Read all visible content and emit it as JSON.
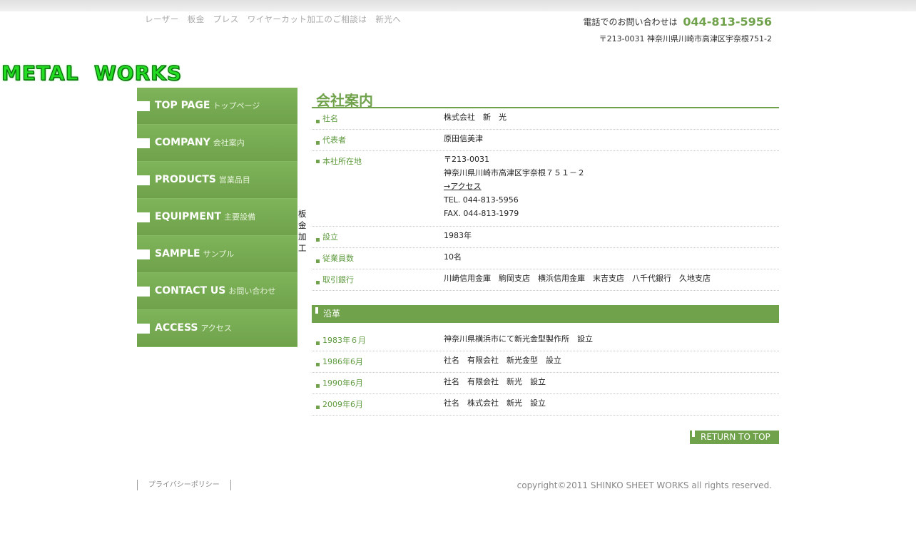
{
  "header": {
    "tagline": "レーザー　板金　プレス　ワイヤーカット加工のご相談は　新光へ",
    "phone_label": "電話でのお問い合わせは",
    "phone_number": "044-813-5956",
    "address": "〒213-0031 神奈川県川崎市高津区宇奈根751-2"
  },
  "logo": {
    "text": "METAL  WORKS"
  },
  "nav": {
    "items": [
      {
        "en": "TOP PAGE",
        "ja": "トップページ"
      },
      {
        "en": "COMPANY",
        "ja": "会社案内"
      },
      {
        "en": "PRODUCTS",
        "ja": "営業品目"
      },
      {
        "en": "EQUIPMENT",
        "ja": "主要設備"
      },
      {
        "en": "SAMPLE",
        "ja": "サンプル"
      },
      {
        "en": "CONTACT US",
        "ja": "お問い合わせ"
      },
      {
        "en": "ACCESS",
        "ja": "アクセス"
      }
    ]
  },
  "vertical_text": [
    "板",
    "金",
    "加",
    "工"
  ],
  "page_title": "会社案内",
  "company": {
    "name_label": "社名",
    "name_value": "株式会社　新　光",
    "rep_label": "代表者",
    "rep_value": "原田信美津",
    "hq_label": "本社所在地",
    "hq_postal": "〒213-0031",
    "hq_address": "神奈川県川崎市高津区宇奈根７５１－２",
    "hq_access_link": "→アクセス",
    "hq_tel": "TEL. 044-813-5956",
    "hq_fax": "FAX. 044-813-1979",
    "founded_label": "設立",
    "founded_value": "1983年",
    "employees_label": "従業員数",
    "employees_value": "10名",
    "banks_label": "取引銀行",
    "banks_value": "川崎信用金庫　駒岡支店　横浜信用金庫　末吉支店　八千代銀行　久地支店"
  },
  "history": {
    "header": "沿革",
    "rows": [
      {
        "date": "1983年６月",
        "event": "神奈川県横浜市にて新光金型製作所　設立"
      },
      {
        "date": "1986年6月",
        "event": "社名　有限会社　新光金型　設立"
      },
      {
        "date": "1990年6月",
        "event": "社名　有限会社　新光　設立"
      },
      {
        "date": "2009年6月",
        "event": "社名　株式会社　新光　設立"
      }
    ]
  },
  "return_to_top": "RETURN TO TOP",
  "footer": {
    "privacy": "プライバシーポリシー",
    "copyright": "copyright©2011 SHINKO SHEET WORKS all rights reserved."
  },
  "colors": {
    "accent": "#6fa24b",
    "logo_green": "#22dd22"
  }
}
